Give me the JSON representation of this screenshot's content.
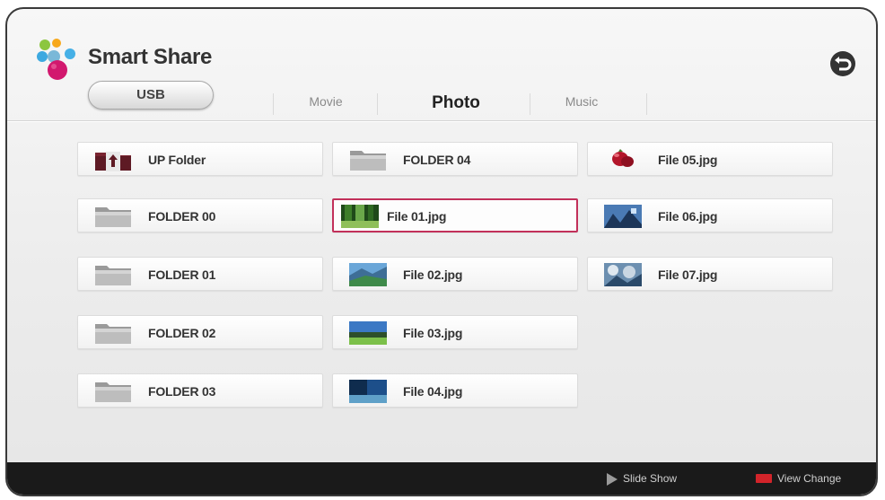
{
  "app": {
    "title": "Smart Share",
    "source_button": "USB"
  },
  "tabs": [
    {
      "label": "Movie",
      "active": false
    },
    {
      "label": "Photo",
      "active": true
    },
    {
      "label": "Music",
      "active": false
    }
  ],
  "grid": {
    "columns": [
      [
        {
          "label": "UP Folder",
          "icon": "up-folder-icon"
        },
        {
          "label": "FOLDER 00",
          "icon": "folder-icon"
        },
        {
          "label": "FOLDER 01",
          "icon": "folder-icon"
        },
        {
          "label": "FOLDER 02",
          "icon": "folder-icon"
        },
        {
          "label": "FOLDER 03",
          "icon": "folder-icon"
        }
      ],
      [
        {
          "label": "FOLDER 04",
          "icon": "folder-icon"
        },
        {
          "label": "File 01.jpg",
          "icon": "photo-thumbnail-icon",
          "selected": true
        },
        {
          "label": "File 02.jpg",
          "icon": "photo-thumbnail-icon"
        },
        {
          "label": "File 03.jpg",
          "icon": "photo-thumbnail-icon"
        },
        {
          "label": "File 04.jpg",
          "icon": "photo-thumbnail-icon"
        }
      ],
      [
        {
          "label": "File 05.jpg",
          "icon": "photo-thumbnail-icon"
        },
        {
          "label": "File 06.jpg",
          "icon": "photo-thumbnail-icon"
        },
        {
          "label": "File 07.jpg",
          "icon": "photo-thumbnail-icon"
        }
      ]
    ]
  },
  "footer": {
    "slide_show": "Slide Show",
    "view_change": "View Change"
  },
  "colors": {
    "selection_border": "#c2305a",
    "footer_bar": "#1a1a1a",
    "view_change_key": "#d2242a"
  }
}
